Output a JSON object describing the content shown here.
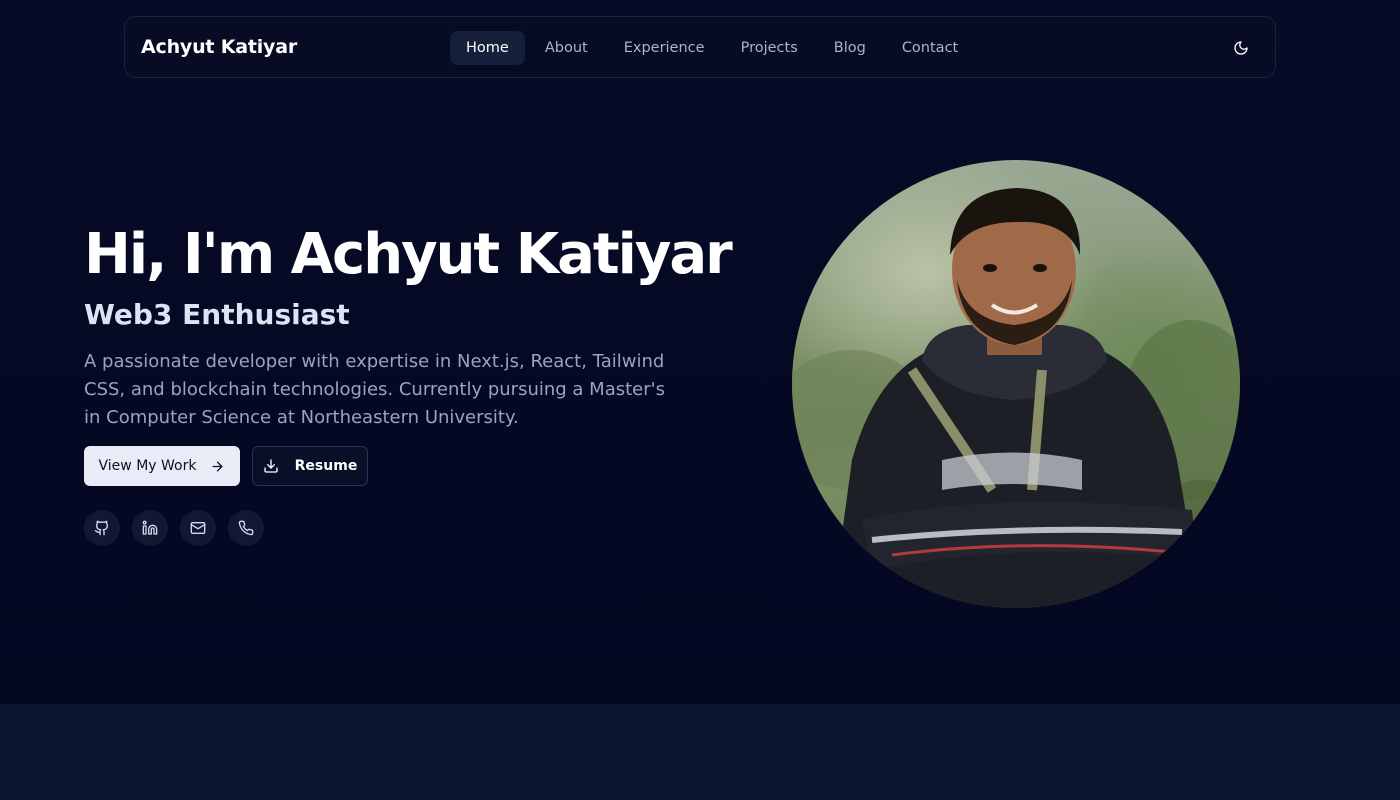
{
  "navbar": {
    "brand": "Achyut Katiyar",
    "links": [
      {
        "label": "Home",
        "active": true
      },
      {
        "label": "About",
        "active": false
      },
      {
        "label": "Experience",
        "active": false
      },
      {
        "label": "Projects",
        "active": false
      },
      {
        "label": "Blog",
        "active": false
      },
      {
        "label": "Contact",
        "active": false
      }
    ],
    "theme_icon": "moon-icon"
  },
  "hero": {
    "title": "Hi, I'm Achyut Katiyar",
    "subtitle": "Web3 Enthusiast",
    "description": "A passionate developer with expertise in Next.js, React, Tailwind CSS, and blockchain technologies. Currently pursuing a Master's in Computer Science at Northeastern University.",
    "primary_button": {
      "label": "View My Work",
      "icon": "arrow-right-icon"
    },
    "secondary_button": {
      "label": "Resume",
      "icon": "download-icon"
    },
    "socials": [
      {
        "name": "github",
        "icon": "github-icon"
      },
      {
        "name": "linkedin",
        "icon": "linkedin-icon"
      },
      {
        "name": "email",
        "icon": "mail-icon"
      },
      {
        "name": "phone",
        "icon": "phone-icon"
      }
    ]
  },
  "colors": {
    "background": "#050a22",
    "nav_active": "#16203a",
    "primary_button_bg": "#e8ecf7",
    "text_muted": "#9aa4bd"
  }
}
